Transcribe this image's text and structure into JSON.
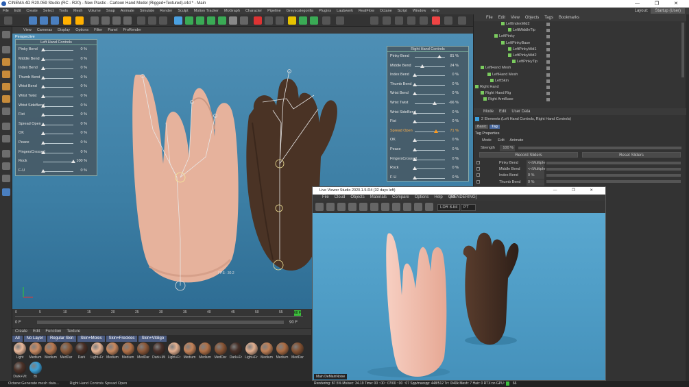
{
  "window": {
    "title": "CINEMA 4D R20.059 Studio (RC - R20) - New Plastic - Cartoon Hand Model (Rigged+Textured).c4d * - Main",
    "controls": "—  ❐  ✕"
  },
  "menu": [
    "File",
    "Edit",
    "Create",
    "Select",
    "Tools",
    "Mesh",
    "Volume",
    "Snap",
    "Animate",
    "Simulate",
    "Render",
    "Sculpt",
    "Motion Tracker",
    "MoGraph",
    "Character",
    "Pipeline",
    "Greyscalegorilla",
    "Plugins",
    "Laubwerk",
    "RealFlow",
    "Octane",
    "Script",
    "Window",
    "Help"
  ],
  "layout": {
    "label": "Layout:",
    "value": "Startup (User)"
  },
  "viewport": {
    "menu": [
      "View",
      "Cameras",
      "Display",
      "Options",
      "Filter",
      "Panel",
      "ProRender"
    ],
    "label": "Perspective",
    "fps": "FPS : 30.2"
  },
  "left_panel": {
    "title": "Left Hand Controls",
    "rows": [
      {
        "label": "Pinky Bend",
        "value": "0 %",
        "pos": 0
      },
      {
        "label": "Middle Bend",
        "value": "0 %",
        "pos": 0
      },
      {
        "label": "Index Bend",
        "value": "0 %",
        "pos": 0
      },
      {
        "label": "Thumb Bend",
        "value": "0 %",
        "pos": 0
      },
      {
        "label": "Wrist Bend",
        "value": "0 %",
        "pos": 0
      },
      {
        "label": "Wrist Twist",
        "value": "0 %",
        "pos": 0
      },
      {
        "label": "Wrist SideBend",
        "value": "0 %",
        "pos": 0
      },
      {
        "label": "Fist",
        "value": "0 %",
        "pos": 0
      },
      {
        "label": "Spread Open",
        "value": "0 %",
        "pos": 0
      },
      {
        "label": "OK",
        "value": "0 %",
        "pos": 0
      },
      {
        "label": "Peace",
        "value": "0 %",
        "pos": 0
      },
      {
        "label": "FingersCrossed",
        "value": "0 %",
        "pos": 0
      },
      {
        "label": "Rock",
        "value": "100 %",
        "pos": 1
      },
      {
        "label": "F-U",
        "value": "0 %",
        "pos": 0
      }
    ]
  },
  "right_panel": {
    "title": "Right Hand Controls",
    "rows": [
      {
        "label": "Pinky Bend",
        "value": "81 %",
        "pos": 0.81
      },
      {
        "label": "Middle Bend",
        "value": "24 %",
        "pos": 0.24
      },
      {
        "label": "Index Bend",
        "value": "0 %",
        "pos": 0
      },
      {
        "label": "Thumb Bend",
        "value": "0 %",
        "pos": 0
      },
      {
        "label": "Wrist Bend",
        "value": "0 %",
        "pos": 0
      },
      {
        "label": "Wrist Twist",
        "value": "-66 %",
        "pos": 0.66
      },
      {
        "label": "Wrist SideBend",
        "value": "0 %",
        "pos": 0
      },
      {
        "label": "Fist",
        "value": "0 %",
        "pos": 0
      },
      {
        "label": "Spread Open",
        "value": "71 %",
        "pos": 0.71,
        "highlight": true
      },
      {
        "label": "OK",
        "value": "0 %",
        "pos": 0
      },
      {
        "label": "Peace",
        "value": "0 %",
        "pos": 0
      },
      {
        "label": "FingersCrossed",
        "value": "0 %",
        "pos": 0
      },
      {
        "label": "Rock",
        "value": "0 %",
        "pos": 0
      },
      {
        "label": "F-U",
        "value": "0 %",
        "pos": 0
      }
    ]
  },
  "timeline": {
    "ticks": [
      "0",
      "5",
      "10",
      "15",
      "20",
      "25",
      "30",
      "35",
      "40",
      "45",
      "50",
      "55"
    ],
    "current": "60 F",
    "start": "0 F",
    "end": "90 F"
  },
  "materials": {
    "menu": [
      "Create",
      "Edit",
      "Function",
      "Texture"
    ],
    "filters": [
      "All",
      "No Layer",
      "Regular Skin",
      "Skin+Moles",
      "Skin+Freckles",
      "Skin+Vitiligo"
    ],
    "items": [
      {
        "label": "Light",
        "color": "#e9b89a"
      },
      {
        "label": "Medium",
        "color": "#c98a62"
      },
      {
        "label": "Medium",
        "color": "#b87850"
      },
      {
        "label": "MedDar",
        "color": "#8a5a3a"
      },
      {
        "label": "Dark",
        "color": "#4a3026"
      },
      {
        "label": "Light+Fr",
        "color": "#e6b494"
      },
      {
        "label": "Medium",
        "color": "#c8885e"
      },
      {
        "label": "Medium",
        "color": "#b47248"
      },
      {
        "label": "MedDar",
        "color": "#8c5838"
      },
      {
        "label": "Dark+Mi",
        "color": "#48302a"
      },
      {
        "label": "Light+Fr",
        "color": "#e3b090"
      },
      {
        "label": "Medium",
        "color": "#c48258"
      },
      {
        "label": "Medium",
        "color": "#b07046"
      },
      {
        "label": "MedDar",
        "color": "#885434"
      },
      {
        "label": "Dark+Fr",
        "color": "#463028"
      },
      {
        "label": "Light+Fr",
        "color": "#e1ae8e"
      },
      {
        "label": "Medium",
        "color": "#c08056"
      },
      {
        "label": "Medium",
        "color": "#ac6c42"
      },
      {
        "label": "MedDar",
        "color": "#845232"
      },
      {
        "label": "Dark+Vit",
        "color": "#4c3228"
      },
      {
        "label": "Bl",
        "color": "#3aa0d8"
      }
    ]
  },
  "status": "Octane:Generate mesh data...",
  "status2": "Right Hand Controls Spread Open",
  "objects": {
    "menu": [
      "File",
      "Edit",
      "View",
      "Objects",
      "Tags",
      "Bookmarks"
    ],
    "rows": [
      "LeftIndexMid2",
      "LeftMiddleTip",
      "LeftPinky",
      "LeftPinkyBase",
      "LeftPinkyMid1",
      "LeftPinkyMid2",
      "LeftPinkyTip",
      "LeftHand Mesh",
      "LeftHand Mesh",
      "LeftSkin",
      "Right Hand",
      "Right Hand Rig",
      "Right ArmBase"
    ]
  },
  "attributes": {
    "menu": [
      "Mode",
      "Edit",
      "User Data"
    ],
    "info": "2 Elements (Left Hand Controls, Right Hand Controls)",
    "tabs": [
      "Basic",
      "Tag"
    ],
    "section": "Tag Properties",
    "mode_row": {
      "label": "Mode",
      "edit": "Edit",
      "animate": "Animate"
    },
    "strength": {
      "label": "Strength",
      "value": "100 %"
    },
    "record": "Record Sliders",
    "reset": "Reset Sliders",
    "rows": [
      {
        "label": "Pinky Bend",
        "value": "<<Multiple"
      },
      {
        "label": "Middle Bend",
        "value": "<<Multiple"
      },
      {
        "label": "Index Bend",
        "value": "0 %"
      },
      {
        "label": "Thumb Bend",
        "value": "0 %"
      }
    ]
  },
  "live_viewer": {
    "title": "Live Viewer Studio 2020.1.5-R4 (32 days left)",
    "menu": [
      "File",
      "Cloud",
      "Objects",
      "Materials",
      "Compare",
      "Options",
      "Help",
      "GUI"
    ],
    "state": "[RENDERING]",
    "ldr": "LDR 8-bit",
    "pt": "PT",
    "label": "Main  DeMainNoise",
    "status": "Rendering: 87.5%   Ms/sec: 34.19   Time: 00 : 00 : 07/00 : 00 : 07   Spp/maxspp: 448/512   Tri: 0/40k   Mesh: 7   Hair: 0   RTX:on   GPU:",
    "gpu": "66"
  },
  "colors": {
    "accent": "#ff9a1c",
    "viewport": "#3c7ea4",
    "panel": "#465a66"
  }
}
